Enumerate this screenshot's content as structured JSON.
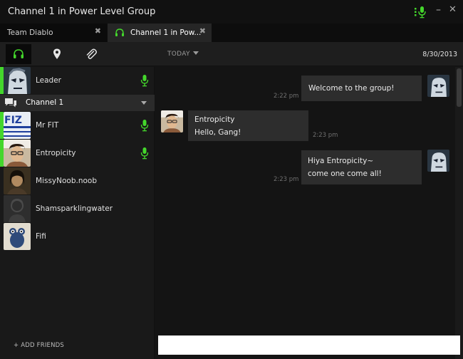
{
  "window": {
    "title": "Channel 1 in Power Level Group"
  },
  "tabs": [
    {
      "label": "Team Diablo",
      "close": "✖"
    },
    {
      "label": "Channel 1 in Pow...",
      "close": "✖"
    }
  ],
  "toolbar": {
    "today_label": "TODAY",
    "date": "8/30/2013"
  },
  "sidebar": {
    "leader": {
      "name": "Leader"
    },
    "channel": {
      "name": "Channel 1"
    },
    "members": [
      {
        "name": "Mr FIT",
        "talking": true
      },
      {
        "name": "Entropicity",
        "talking": true
      },
      {
        "name": "MissyNoob.noob",
        "talking": false
      },
      {
        "name": "Shamsparklingwater",
        "talking": false
      },
      {
        "name": "Fifi",
        "talking": false
      }
    ],
    "add_friends": "+ ADD FRIENDS"
  },
  "chat": {
    "messages": [
      {
        "side": "right",
        "lines": [
          "Welcome to the group!"
        ],
        "time": "2:22 pm"
      },
      {
        "side": "left",
        "lines": [
          "Entropicity",
          "Hello, Gang!"
        ],
        "time": "2:23 pm"
      },
      {
        "side": "right",
        "lines": [
          "Hiya Entropicity~",
          "come one come all!"
        ],
        "time": "2:23 pm"
      }
    ],
    "input_placeholder": ""
  },
  "colors": {
    "accent": "#44d62c",
    "bubble": "#2d2d2d",
    "background": "#141414"
  },
  "icons": [
    "mic-icon",
    "headset-icon",
    "location-pin-icon",
    "paperclip-icon",
    "chat-bubble-icon"
  ]
}
